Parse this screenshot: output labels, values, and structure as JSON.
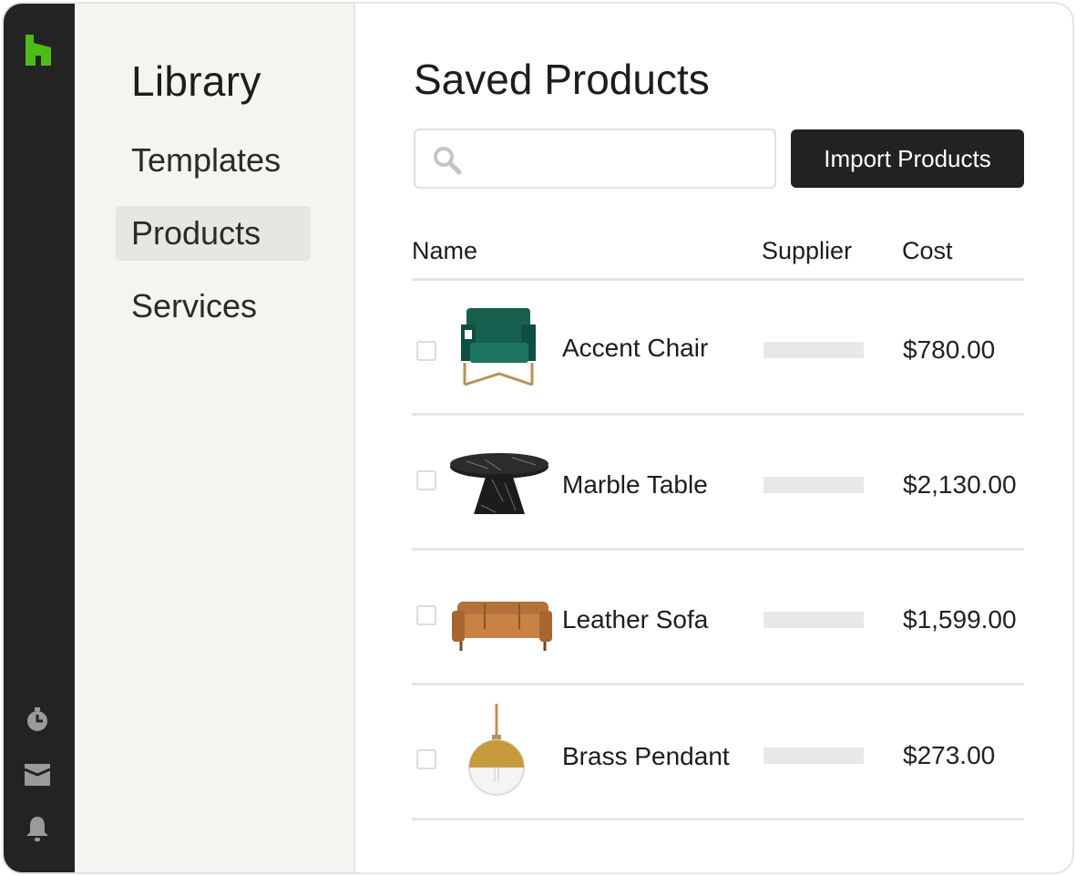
{
  "rail": {
    "logo": "houzz-logo-icon",
    "icons": [
      "stopwatch-icon",
      "inbox-icon",
      "bell-icon"
    ],
    "accent": "#4dbc15",
    "background": "#232323"
  },
  "library": {
    "title": "Library",
    "items": [
      {
        "label": "Templates",
        "active": false
      },
      {
        "label": "Products",
        "active": true
      },
      {
        "label": "Services",
        "active": false
      }
    ]
  },
  "main": {
    "title": "Saved Products",
    "search": {
      "placeholder": "",
      "value": "",
      "icon": "search-icon"
    },
    "import_label": "Import Products",
    "columns": {
      "name": "Name",
      "supplier": "Supplier",
      "cost": "Cost"
    },
    "rows": [
      {
        "name": "Accent Chair",
        "cost": "$780.00",
        "image": "green-velvet-armchair"
      },
      {
        "name": "Marble Table",
        "cost": "$2,130.00",
        "image": "black-marble-round-table"
      },
      {
        "name": "Leather Sofa",
        "cost": "$1,599.00",
        "image": "tan-leather-sofa"
      },
      {
        "name": "Brass Pendant",
        "cost": "$273.00",
        "image": "brass-globe-pendant-light"
      }
    ]
  }
}
